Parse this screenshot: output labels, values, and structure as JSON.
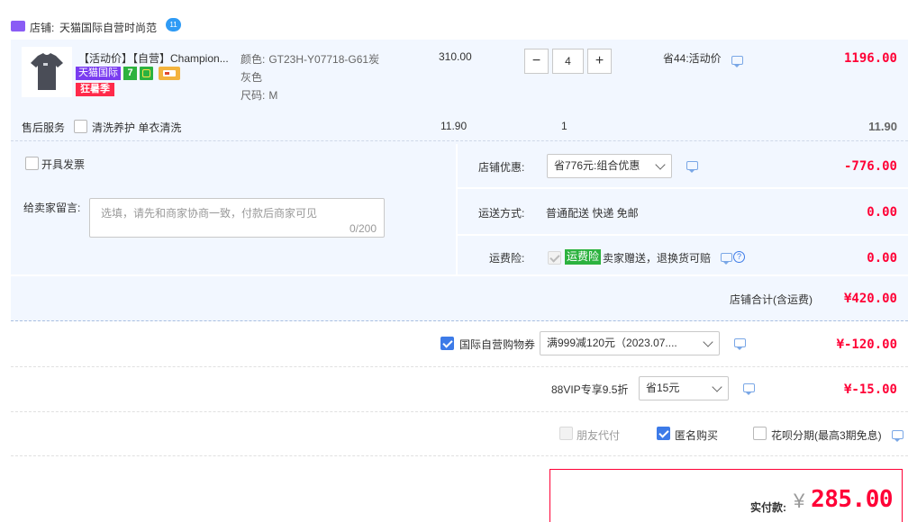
{
  "shop": {
    "prefix": "店铺: ",
    "name": "天猫国际自营时尚范",
    "badge": "11"
  },
  "item": {
    "title": "【活动价】【自营】Champion...",
    "tags": {
      "tmall_intl": "天猫国际",
      "seven_day": "7",
      "crazy_summer": "狂暑季"
    },
    "attrs": {
      "color_label": "颜色:",
      "color_value": "GT23H-Y07718-G61炭",
      "color_value_2": "灰色",
      "size_label": "尺码:",
      "size_value": "M"
    },
    "unit_price": "310.00",
    "quantity": "4",
    "minus": "−",
    "plus": "+",
    "discount_note": "省44:活动价",
    "subtotal": "1196.00"
  },
  "service": {
    "label": "售后服务",
    "option": "清洗养护 单衣清洗",
    "price": "11.90",
    "qty": "1",
    "subtotal": "11.90"
  },
  "invoice": {
    "label": "开具发票"
  },
  "message": {
    "label": "给卖家留言:",
    "placeholder": "选填，请先和商家协商一致，付款后商家可见",
    "counter": "0/200"
  },
  "store_discount": {
    "label": "店铺优惠:",
    "selected": "省776元:组合优惠",
    "amount": "-776.00"
  },
  "shipping": {
    "label": "运送方式:",
    "value": "普通配送 快递 免邮",
    "amount": "0.00"
  },
  "insurance": {
    "label": "运费险:",
    "badge": "运费险",
    "value": "卖家赠送，退换货可赔",
    "help": "?",
    "amount": "0.00"
  },
  "store_total": {
    "label": "店铺合计(含运费)",
    "amount": "¥420.00"
  },
  "coupon": {
    "label": "国际自营购物券",
    "selected": "满999减120元（2023.07....",
    "amount": "¥-120.00"
  },
  "vip": {
    "label": "88VIP专享9.5折",
    "selected": "省15元",
    "amount": "¥-15.00"
  },
  "options": {
    "friend_pay": "朋友代付",
    "anonymous": "匿名购买",
    "huabei": "花呗分期(最高3期免息)"
  },
  "pay": {
    "label": "实付款:",
    "currency": "¥",
    "amount": "285.00"
  },
  "colors": {
    "accent_red": "#ff0036",
    "panel_bg": "#f2f7ff",
    "link_blue": "#3d7be8"
  }
}
